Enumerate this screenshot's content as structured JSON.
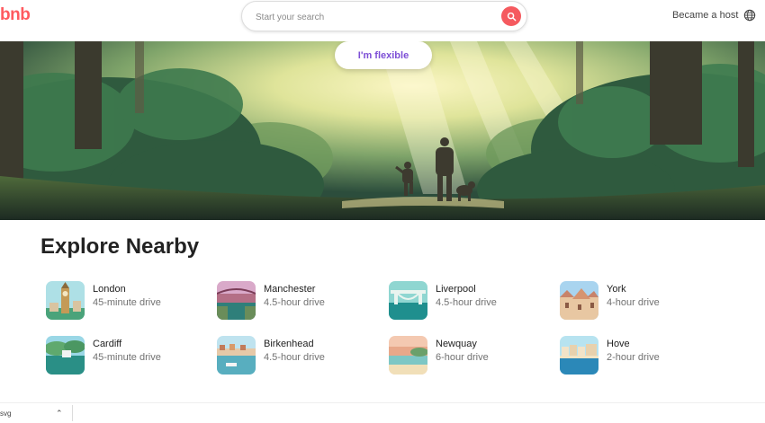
{
  "header": {
    "logo_text": "bnb",
    "search": {
      "placeholder": "Start your search",
      "button_icon": "search-icon"
    },
    "host_label": "Became a host",
    "globe_icon": "globe-icon"
  },
  "hero": {
    "flexible_label": "I'm flexible"
  },
  "explore": {
    "title": "Explore Nearby",
    "items": [
      {
        "city": "London",
        "drive": "45-minute drive"
      },
      {
        "city": "Manchester",
        "drive": "4.5-hour drive"
      },
      {
        "city": "Liverpool",
        "drive": "4.5-hour drive"
      },
      {
        "city": "York",
        "drive": "4-hour drive"
      },
      {
        "city": "Cardiff",
        "drive": "45-minute drive"
      },
      {
        "city": "Birkenhead",
        "drive": "4.5-hour drive"
      },
      {
        "city": "Newquay",
        "drive": "6-hour drive"
      },
      {
        "city": "Hove",
        "drive": "2-hour drive"
      }
    ]
  },
  "bottom_bar": {
    "download_name": "svg",
    "chevron_icon": "chevron-up-icon"
  },
  "colors": {
    "brand": "#ff5a5f",
    "flexible_text": "#7d4fd6"
  }
}
